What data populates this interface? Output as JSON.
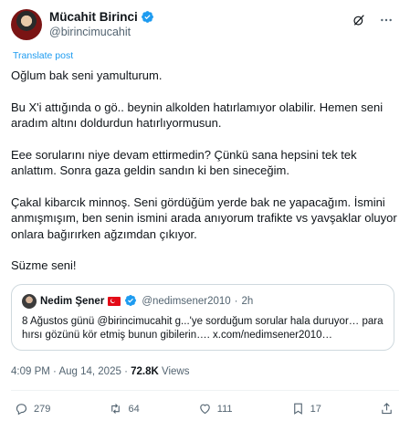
{
  "author": {
    "name": "Mücahit Birinci",
    "handle": "@birincimucahit"
  },
  "translate_label": "Translate post",
  "paragraphs": [
    "Oğlum bak seni yamulturum.",
    "Bu X'i attığında o gö.. beynin alkolden hatırlamıyor olabilir. Hemen seni aradım altını doldurdun hatırlıyormusun.",
    "Eee sorularını niye devam ettirmedin? Çünkü sana hepsini tek tek anlattım. Sonra gaza geldin sandın ki ben sineceğim.",
    "Çakal kibarcık minnoş. Seni gördüğüm yerde bak ne yapacağım. İsmini anmışmışım,  ben senin ismini arada anıyorum trafikte vs yavşaklar oluyor onlara bağırırken ağzımdan çıkıyor.",
    "Süzme seni!"
  ],
  "quote": {
    "name": "Nedim Şener",
    "handle": "@nedimsener2010",
    "separator": "·",
    "age": "2h",
    "text": "8 Ağustos günü @birincimucahit g...'ye sorduğum sorular hala duruyor… para hırsı gözünü kör etmiş bunun gibilerin…. x.com/nedimsener2010…"
  },
  "meta": {
    "time": "4:09 PM",
    "sep": "·",
    "date": "Aug 14, 2025",
    "views_count": "72.8K",
    "views_label": "Views"
  },
  "actions": {
    "replies": "279",
    "reposts": "64",
    "likes": "111",
    "bookmarks": "17"
  },
  "colors": {
    "accent": "#1d9bf0",
    "secondary_text": "#536471",
    "border": "#cfd9de"
  }
}
